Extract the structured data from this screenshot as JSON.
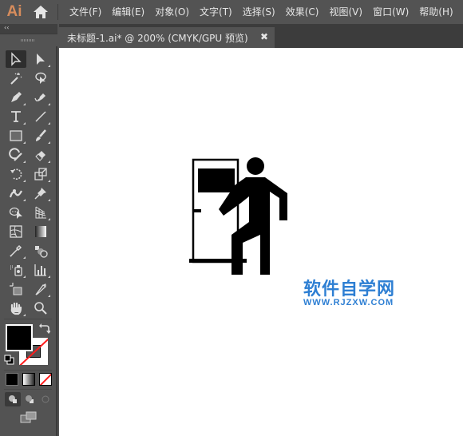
{
  "app": {
    "logo": "Ai"
  },
  "menu": [
    {
      "label": "文件(F)"
    },
    {
      "label": "编辑(E)"
    },
    {
      "label": "对象(O)"
    },
    {
      "label": "文字(T)"
    },
    {
      "label": "选择(S)"
    },
    {
      "label": "效果(C)"
    },
    {
      "label": "视图(V)"
    },
    {
      "label": "窗口(W)"
    },
    {
      "label": "帮助(H)"
    }
  ],
  "panel": {
    "collapse_label": "‹‹"
  },
  "document_tab": {
    "title": "未标题-1.ai* @ 200% (CMYK/GPU 预览)",
    "close": "✖"
  },
  "tools": [
    "selection-tool",
    "direct-selection-tool",
    "magic-wand-tool",
    "lasso-tool",
    "pen-tool",
    "curvature-tool",
    "type-tool",
    "line-segment-tool",
    "rectangle-tool",
    "paintbrush-tool",
    "shaper-tool",
    "eraser-tool",
    "rotate-tool",
    "scale-tool",
    "warp-tool",
    "puppet-warp-tool",
    "shape-builder-tool",
    "perspective-grid-tool",
    "mesh-tool",
    "gradient-tool",
    "eyedropper-tool",
    "blend-tool",
    "symbol-sprayer-tool",
    "column-graph-tool",
    "artboard-tool",
    "slice-tool",
    "hand-tool",
    "zoom-tool"
  ],
  "colors": {
    "fill": "#000000",
    "stroke": "none",
    "accent_red": "#ff1e1e",
    "watermark": "#2e7fd3"
  },
  "canvas": {
    "artwork": "person-exiting-door-icon",
    "watermark_title": "软件自学网",
    "watermark_url": "WWW.RJZXW.COM"
  }
}
